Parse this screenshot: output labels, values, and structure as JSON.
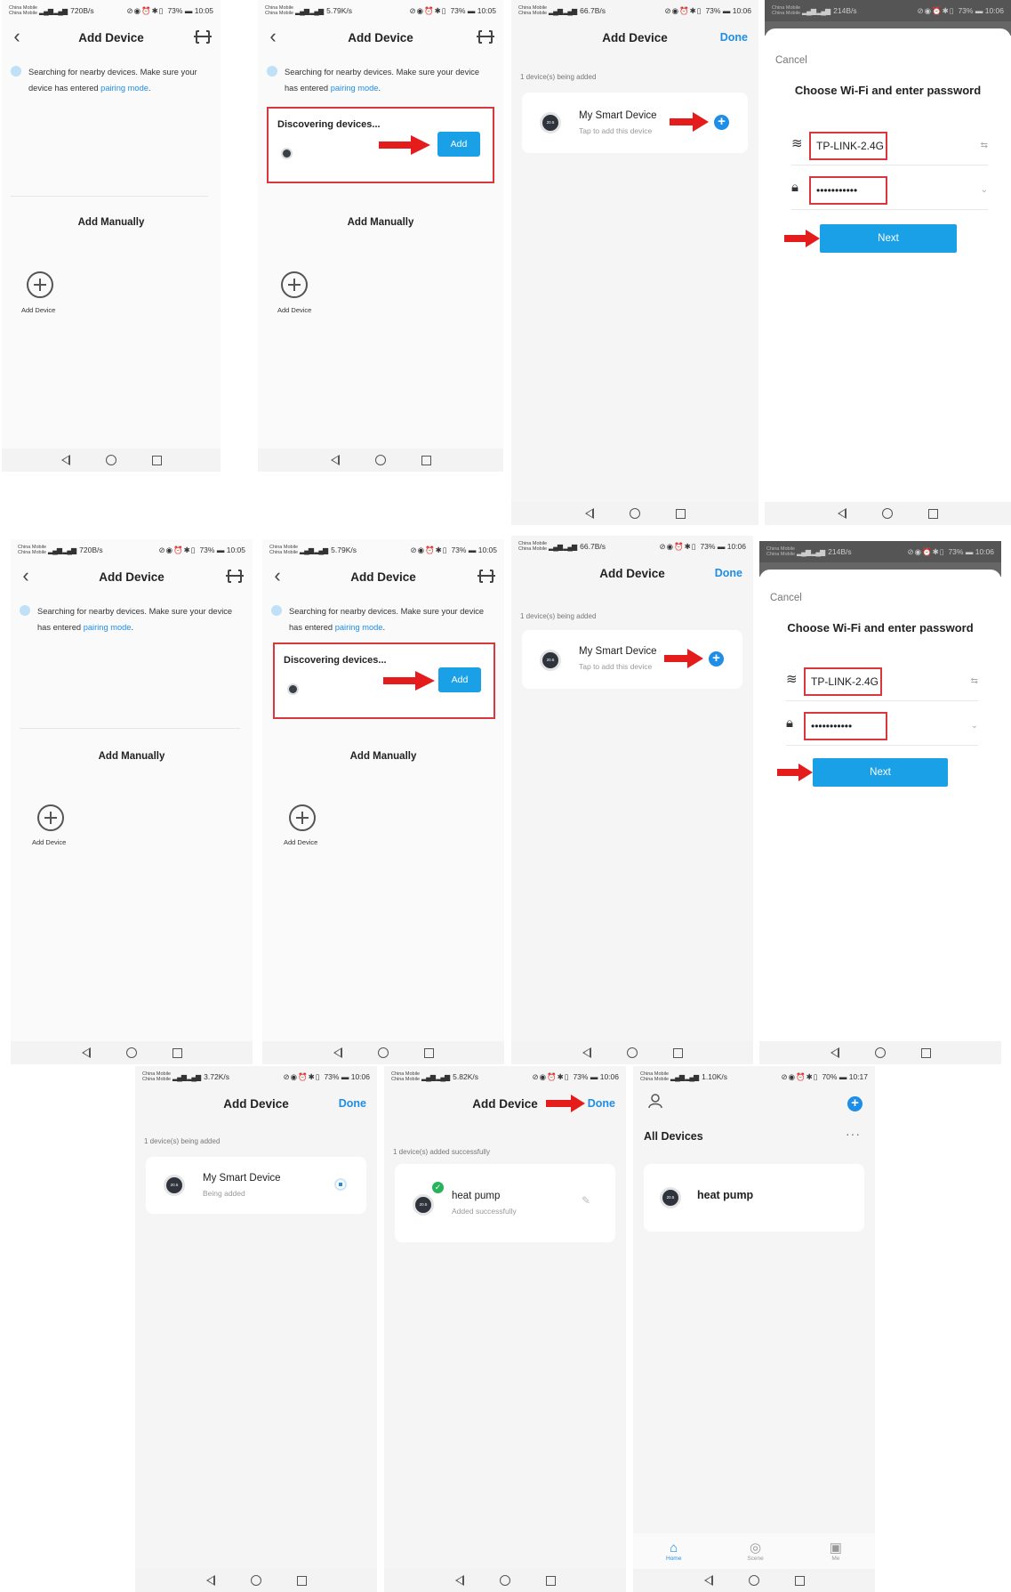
{
  "status": {
    "carrier": "China Mobile",
    "carrier2": "China Mobile",
    "s1": {
      "speed": "720B/s",
      "battery": "73%",
      "time": "10:05"
    },
    "s2": {
      "speed": "5.79K/s",
      "battery": "73%",
      "time": "10:05"
    },
    "s3": {
      "speed": "66.7B/s",
      "battery": "73%",
      "time": "10:06"
    },
    "s4": {
      "speed": "214B/s",
      "battery": "73%",
      "time": "10:06"
    },
    "s5": {
      "speed": "720B/s",
      "battery": "73%",
      "time": "10:05"
    },
    "s6": {
      "speed": "5.79K/s",
      "battery": "73%",
      "time": "10:05"
    },
    "s7": {
      "speed": "66.7B/s",
      "battery": "73%",
      "time": "10:06"
    },
    "s8": {
      "speed": "214B/s",
      "battery": "73%",
      "time": "10:06"
    },
    "s9": {
      "speed": "3.72K/s",
      "battery": "73%",
      "time": "10:06"
    },
    "s10": {
      "speed": "5.82K/s",
      "battery": "73%",
      "time": "10:06"
    },
    "s11": {
      "speed": "1.10K/s",
      "battery": "70%",
      "time": "10:17"
    }
  },
  "nav": {
    "add_device_title": "Add Device",
    "done": "Done"
  },
  "search": {
    "text": "Searching for nearby devices. Make sure your device has entered",
    "link": "pairing mode",
    "period": "."
  },
  "discover": {
    "label": "Discovering devices...",
    "add_button": "Add"
  },
  "manual": {
    "title": "Add Manually",
    "add_device_label": "Add Device"
  },
  "being_added": {
    "count_label": "1 device(s) being added",
    "device_name": "My Smart Device",
    "tap_hint": "Tap to add this device",
    "status_being_added": "Being added"
  },
  "wifi": {
    "cancel": "Cancel",
    "title": "Choose Wi-Fi and enter password",
    "ssid": "TP-LINK-2.4G",
    "password": "•••••••••••",
    "next": "Next"
  },
  "success": {
    "count_label": "1 device(s) added successfully",
    "device_name": "heat pump",
    "status": "Added successfully"
  },
  "home": {
    "all_devices": "All Devices",
    "device_name": "heat pump",
    "tabs": [
      "Home",
      "Scene",
      "Me"
    ]
  },
  "thumb_text": "20.5",
  "colors": {
    "accent": "#1e8ee6",
    "button": "#1aa0e6",
    "highlight": "#d9363e",
    "success": "#26b35a"
  }
}
